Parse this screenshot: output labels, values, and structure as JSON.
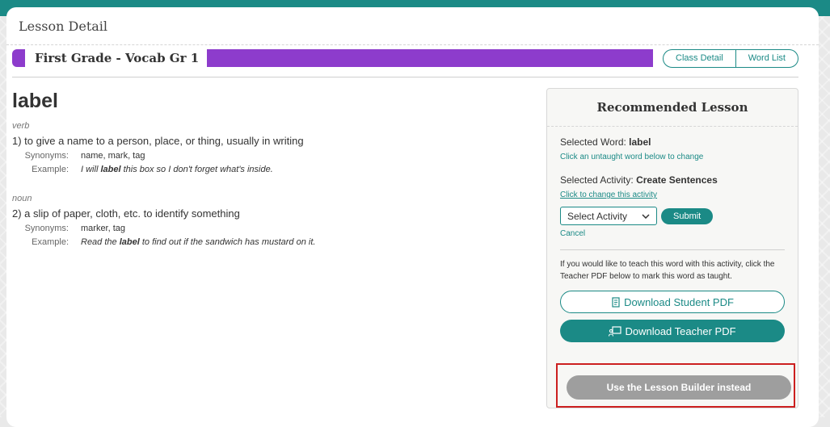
{
  "panel": {
    "title": "Lesson Detail"
  },
  "lesson": {
    "name": "First Grade - Vocab Gr 1",
    "accent_color": "#8d3ccc",
    "links": [
      "Class Detail",
      "Word List"
    ]
  },
  "word": {
    "title": "label",
    "senses": [
      {
        "pos": "verb",
        "definition": "1) to give a name to a person, place, or thing, usually in writing",
        "synonyms_label": "Synonyms:",
        "synonyms": "name, mark, tag",
        "example_label": "Example:",
        "example_before": "I will ",
        "example_bold": "label",
        "example_after": " this box so I don't forget what's inside."
      },
      {
        "pos": "noun",
        "definition": "2) a slip of paper, cloth, etc. to identify something",
        "synonyms_label": "Synonyms:",
        "synonyms": "marker, tag",
        "example_label": "Example:",
        "example_before": "Read the ",
        "example_bold": "label",
        "example_after": " to find out if the sandwich has mustard on it."
      }
    ]
  },
  "recommended": {
    "title": "Recommended Lesson",
    "selected_word_label": "Selected Word:",
    "selected_word": "label",
    "word_hint": "Click an untaught word below to change",
    "selected_activity_label": "Selected Activity:",
    "selected_activity": "Create Sentences",
    "activity_hint": "Click to change this activity",
    "select_value": "Select Activity",
    "submit_label": "Submit",
    "cancel_label": "Cancel",
    "note": "If you would like to teach this word with this activity, click the Teacher PDF below to mark this word as taught.",
    "student_pdf_label": "Download Student PDF",
    "teacher_pdf_label": "Download Teacher PDF",
    "builder_label": "Use the Lesson Builder instead"
  },
  "colors": {
    "teal": "#1b8a86",
    "highlight": "#cc1f1f",
    "disabled": "#9e9e9e"
  }
}
